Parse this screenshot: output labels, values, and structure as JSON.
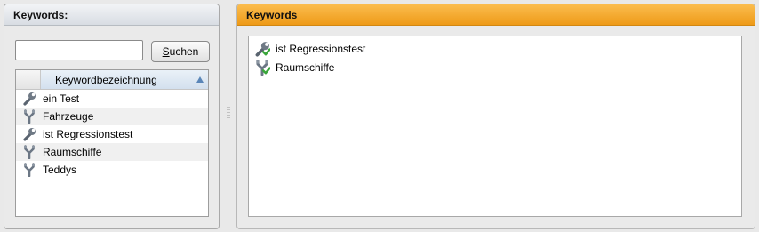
{
  "left_panel": {
    "title": "Keywords:",
    "search": {
      "value": "",
      "placeholder": ""
    },
    "search_button": {
      "prefix": "S",
      "rest": "uchen"
    },
    "grid": {
      "column_header": "Keywordbezeichnung",
      "sort": "ascending",
      "rows": [
        {
          "label": "ein Test",
          "icon": "wrench-icon"
        },
        {
          "label": "Fahrzeuge",
          "icon": "fork-icon"
        },
        {
          "label": "ist Regressionstest",
          "icon": "wrench-icon"
        },
        {
          "label": "Raumschiffe",
          "icon": "fork-icon"
        },
        {
          "label": "Teddys",
          "icon": "fork-icon"
        }
      ]
    }
  },
  "right_panel": {
    "title": "Keywords",
    "accent_color": "#f5a623",
    "items": [
      {
        "label": "ist Regressionstest",
        "icon": "wrench-check-icon"
      },
      {
        "label": "Raumschiffe",
        "icon": "fork-check-icon"
      }
    ]
  }
}
